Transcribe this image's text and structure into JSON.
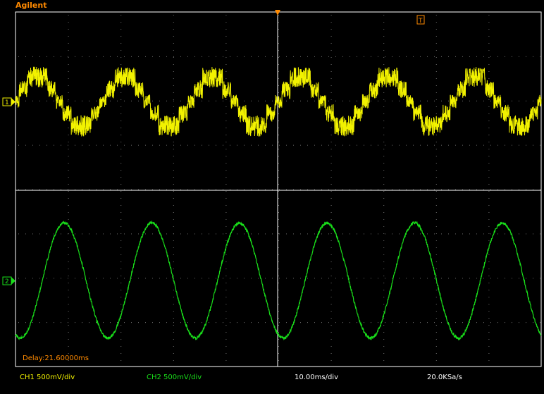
{
  "app": {
    "brand": "Agilent"
  },
  "colors": {
    "background": "#000000",
    "brand": "#ff8a00",
    "grid": "#6e6e6e",
    "ch1": "#f2f200",
    "ch2": "#19e01a",
    "delay": "#ff8a00",
    "white": "#ffffff"
  },
  "markers": {
    "trigger_position": "T",
    "ch1_ground": "1",
    "ch2_ground": "2"
  },
  "channels": [
    {
      "id": "CH1",
      "label": "CH1 500mV/div",
      "color": "#f2f200"
    },
    {
      "id": "CH2",
      "label": "CH2 500mV/div",
      "color": "#19e01a"
    }
  ],
  "timebase": {
    "label": "10.00ms/div",
    "sample_rate": "20.0KSa/s",
    "delay": "Delay:21.60000ms"
  },
  "chart_data": [
    {
      "type": "line",
      "name": "CH1",
      "description_units": "voltage level in divisions relative to CH1 ground marker",
      "x": [
        0,
        0.25,
        0.5,
        0.75,
        1,
        1.25,
        1.5,
        1.75,
        2,
        2.25,
        2.5,
        2.75,
        3,
        3.25,
        3.5,
        3.75,
        4,
        4.25,
        4.5,
        4.75,
        5,
        5.25,
        5.5,
        5.75,
        6,
        6.25,
        6.5,
        6.75,
        7,
        7.25,
        7.5,
        7.75,
        8,
        8.25,
        8.5,
        8.75,
        9,
        9.25,
        9.5,
        9.75,
        10
      ],
      "y": [
        0,
        0.6,
        1.1,
        0.9,
        0.3,
        -0.3,
        -0.9,
        -1.1,
        -0.6,
        0.0,
        0.6,
        1.1,
        0.9,
        0.3,
        -0.3,
        -0.9,
        -1.1,
        -0.6,
        0,
        0.6,
        1.1,
        0.9,
        0.3,
        -0.3,
        -0.9,
        -1.1,
        -0.6,
        0,
        0.6,
        1.1,
        0.9,
        0.3,
        -0.3,
        -0.9,
        -1.1,
        -0.6,
        0,
        0.6,
        1.1,
        0.9,
        0.3
      ]
    },
    {
      "type": "line",
      "name": "CH2",
      "description_units": "voltage level in divisions relative to CH2 ground marker",
      "x": [
        0,
        0.25,
        0.5,
        0.75,
        1,
        1.25,
        1.5,
        1.75,
        2,
        2.25,
        2.5,
        2.75,
        3,
        3.25,
        3.5,
        3.75,
        4,
        4.25,
        4.5,
        4.75,
        5,
        5.25,
        5.5,
        5.75,
        6,
        6.25,
        6.5,
        6.75,
        7,
        7.25,
        7.5,
        7.75,
        8,
        8.25,
        8.5,
        8.75,
        9,
        9.25,
        9.5,
        9.75,
        10
      ],
      "y": [
        -2.4,
        -1.2,
        0.4,
        1.8,
        2.4,
        1.8,
        0.3,
        -1.3,
        -2.4,
        -1.6,
        0,
        1.6,
        2.4,
        1.6,
        0,
        -1.6,
        -2.4,
        -1.6,
        0,
        1.6,
        2.4,
        1.6,
        0,
        -1.6,
        -2.4,
        -1.6,
        0,
        1.6,
        2.4,
        1.6,
        0,
        -1.6,
        -2.4,
        -1.6,
        0,
        1.6,
        2.4,
        1.6,
        0,
        -1.6,
        -2.4
      ]
    }
  ]
}
